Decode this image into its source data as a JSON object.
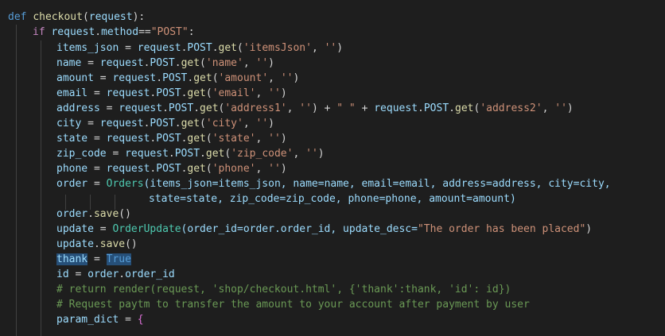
{
  "code": {
    "l1": {
      "kw": "def",
      "fn": "checkout",
      "p1": "(",
      "param": "request",
      "p2": "):"
    },
    "l2": {
      "kw": "if",
      "var": "request",
      "dot": ".",
      "attr": "method",
      "op": "==",
      "str": "\"POST\"",
      "colon": ":"
    },
    "l3": {
      "a": "items_json",
      "b": " = ",
      "c": "request",
      "d": ".",
      "e": "POST",
      "f": ".",
      "g": "get",
      "h": "(",
      "s1": "'itemsJson'",
      "i": ", ",
      "s2": "''",
      "j": ")"
    },
    "l4": {
      "a": "name",
      "b": " = ",
      "c": "request",
      "d": ".",
      "e": "POST",
      "f": ".",
      "g": "get",
      "h": "(",
      "s1": "'name'",
      "i": ", ",
      "s2": "''",
      "j": ")"
    },
    "l5": {
      "a": "amount",
      "b": " = ",
      "c": "request",
      "d": ".",
      "e": "POST",
      "f": ".",
      "g": "get",
      "h": "(",
      "s1": "'amount'",
      "i": ", ",
      "s2": "''",
      "j": ")"
    },
    "l6": {
      "a": "email",
      "b": " = ",
      "c": "request",
      "d": ".",
      "e": "POST",
      "f": ".",
      "g": "get",
      "h": "(",
      "s1": "'email'",
      "i": ", ",
      "s2": "''",
      "j": ")"
    },
    "l7": {
      "a": "address",
      "b": " = ",
      "c": "request",
      "d": ".",
      "e": "POST",
      "f": ".",
      "g": "get",
      "h": "(",
      "s1": "'address1'",
      "i": ", ",
      "s2": "''",
      "j": ") + ",
      "s3": "\" \"",
      "k": " + ",
      "c2": "request",
      "d2": ".",
      "e2": "POST",
      "f2": ".",
      "g2": "get",
      "h2": "(",
      "s4": "'address2'",
      "i2": ", ",
      "s5": "''",
      "j2": ")"
    },
    "l8": {
      "a": "city",
      "b": " = ",
      "c": "request",
      "d": ".",
      "e": "POST",
      "f": ".",
      "g": "get",
      "h": "(",
      "s1": "'city'",
      "i": ", ",
      "s2": "''",
      "j": ")"
    },
    "l9": {
      "a": "state",
      "b": " = ",
      "c": "request",
      "d": ".",
      "e": "POST",
      "f": ".",
      "g": "get",
      "h": "(",
      "s1": "'state'",
      "i": ", ",
      "s2": "''",
      "j": ")"
    },
    "l10": {
      "a": "zip_code",
      "b": " = ",
      "c": "request",
      "d": ".",
      "e": "POST",
      "f": ".",
      "g": "get",
      "h": "(",
      "s1": "'zip_code'",
      "i": ", ",
      "s2": "''",
      "j": ")"
    },
    "l11": {
      "a": "phone",
      "b": " = ",
      "c": "request",
      "d": ".",
      "e": "POST",
      "f": ".",
      "g": "get",
      "h": "(",
      "s1": "'phone'",
      "i": ", ",
      "s2": "''",
      "j": ")"
    },
    "l12": {
      "a": "order",
      "b": " = ",
      "cls": "Orders",
      "rest": "(items_json=items_json, name=name, email=email, address=address, city=city,"
    },
    "l13": {
      "rest": "state=state, zip_code=zip_code, phone=phone, amount=amount)"
    },
    "l14": {
      "a": "order",
      "b": ".",
      "fn": "save",
      "c": "()"
    },
    "l15": {
      "a": "update",
      "b": " = ",
      "cls": "OrderUpdate",
      "c": "(order_id=order.order_id, update_desc=",
      "s": "\"The order has been placed\"",
      "d": ")"
    },
    "l16": {
      "a": "update",
      "b": ".",
      "fn": "save",
      "c": "()"
    },
    "l17": {
      "a": "thank",
      "b": " = ",
      "kw": "True"
    },
    "l18": {
      "a": "id",
      "b": " = ",
      "c": "order",
      "d": ".",
      "e": "order_id"
    },
    "l19": {
      "cmt": "# return render(request, 'shop/checkout.html', {'thank':thank, 'id': id})"
    },
    "l20": {
      "cmt": "# Request paytm to transfer the amount to your account after payment by user"
    },
    "l21": {
      "a": "param_dict",
      "b": " = ",
      "c": "{"
    }
  }
}
